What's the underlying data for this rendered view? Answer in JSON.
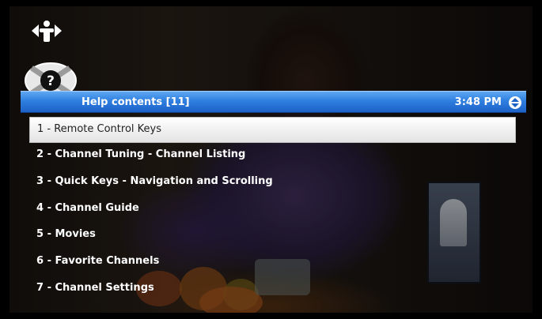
{
  "header": {
    "title": "Help contents [11]",
    "time": "3:48 PM"
  },
  "icons": {
    "top": "navigation-info-icon",
    "help": "help-question-icon",
    "scroll": "up-down-arrows-icon"
  },
  "menu": {
    "items": [
      {
        "label": "1 - Remote Control Keys",
        "selected": true
      },
      {
        "label": "2 - Channel Tuning - Channel Listing"
      },
      {
        "label": "3 - Quick Keys - Navigation and Scrolling"
      },
      {
        "label": "4 - Channel Guide"
      },
      {
        "label": "5 - Movies"
      },
      {
        "label": "6 - Favorite Channels"
      },
      {
        "label": "7 - Channel Settings"
      }
    ]
  },
  "colors": {
    "title_bar": "#2f7fe0",
    "selected_row": "#ffffff",
    "text": "#ffffff"
  }
}
